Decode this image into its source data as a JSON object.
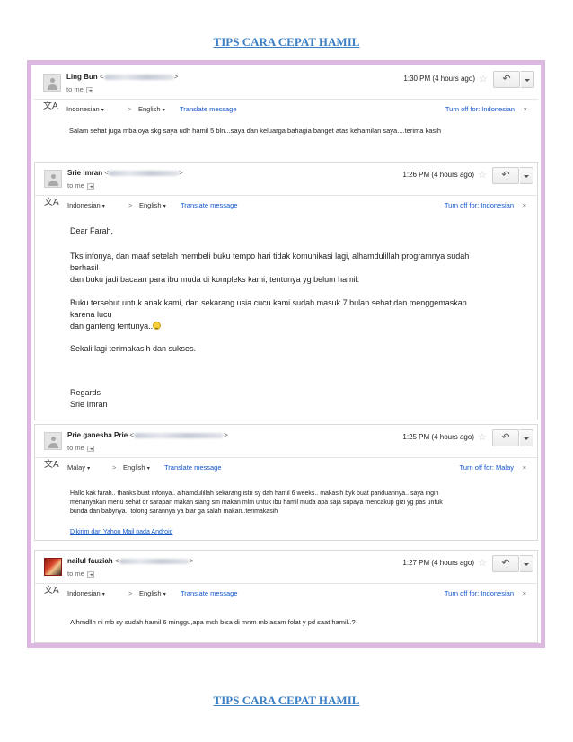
{
  "document": {
    "title_top": "TIPS CARA CEPAT HAMIL",
    "title_bottom": "TIPS CARA CEPAT HAMIL"
  },
  "ui": {
    "to_me": "to me",
    "from_lang_indonesian": "Indonesian",
    "from_lang_malay": "Malay",
    "arrow": ">",
    "to_lang": "English",
    "translate_message": "Translate message",
    "turn_off_indonesian": "Turn off for: Indonesian",
    "turn_off_malay": "Turn off for: Malay",
    "close": "×",
    "caret": "▾",
    "star": "☆",
    "reply": "↶",
    "translate_icon": "文A"
  },
  "emails": [
    {
      "sender": "Ling Bun",
      "time": "1:30 PM (4 hours ago)",
      "body": "Salam sehat juga mba,oya skg saya udh hamil 5 bln...saya dan keluarga bahagia banget atas kehamilan saya....terima kasih"
    },
    {
      "sender": "Srie Imran",
      "time": "1:26 PM (4 hours ago)",
      "greeting": "Dear Farah,",
      "p1_line1": "Tks infonya, dan maaf setelah membeli buku tempo hari  tidak komunikasi lagi, alhamdulillah programnya sudah",
      "p1_line2": "berhasil",
      "p1_line3": "dan buku jadi bacaan para ibu muda di kompleks kami, tentunya yg belum hamil.",
      "p2_line1": "Buku tersebut untuk anak kami, dan sekarang usia cucu kami sudah masuk 7 bulan sehat dan menggemaskan",
      "p2_line2": "karena lucu",
      "p2_line3": "dan ganteng tentunya..",
      "p3": "Sekali lagi terimakasih dan sukses.",
      "sign1": "Regards",
      "sign2": "Srie Imran"
    },
    {
      "sender": "Prie ganesha Prie",
      "time": "1:25 PM (4 hours ago)",
      "line1": "Hallo kak farah.. thanks buat infonya.. alhamdulillah sekarang istri sy dah hamil 6 weeks.. makasih byk buat panduannya.. saya ingin",
      "line2": "menanyakan menu sehat dr sarapan makan siang sm makan mlm untuk ibu hamil muda apa saja supaya mencakup gizi yg pas untuk",
      "line3": "bunda dan babynya.. tolong sarannya ya biar ga salah makan..terimakasih",
      "link": "Dikirim dari Yahoo Mail pada Android"
    },
    {
      "sender": "nailul fauziah",
      "time": "1:27 PM (4 hours ago)",
      "body": "Alhmdllh ni mb sy sudah hamil 6 minggu,apa msh bisa di mnm mb asam folat y pd saat hamil..?"
    }
  ]
}
